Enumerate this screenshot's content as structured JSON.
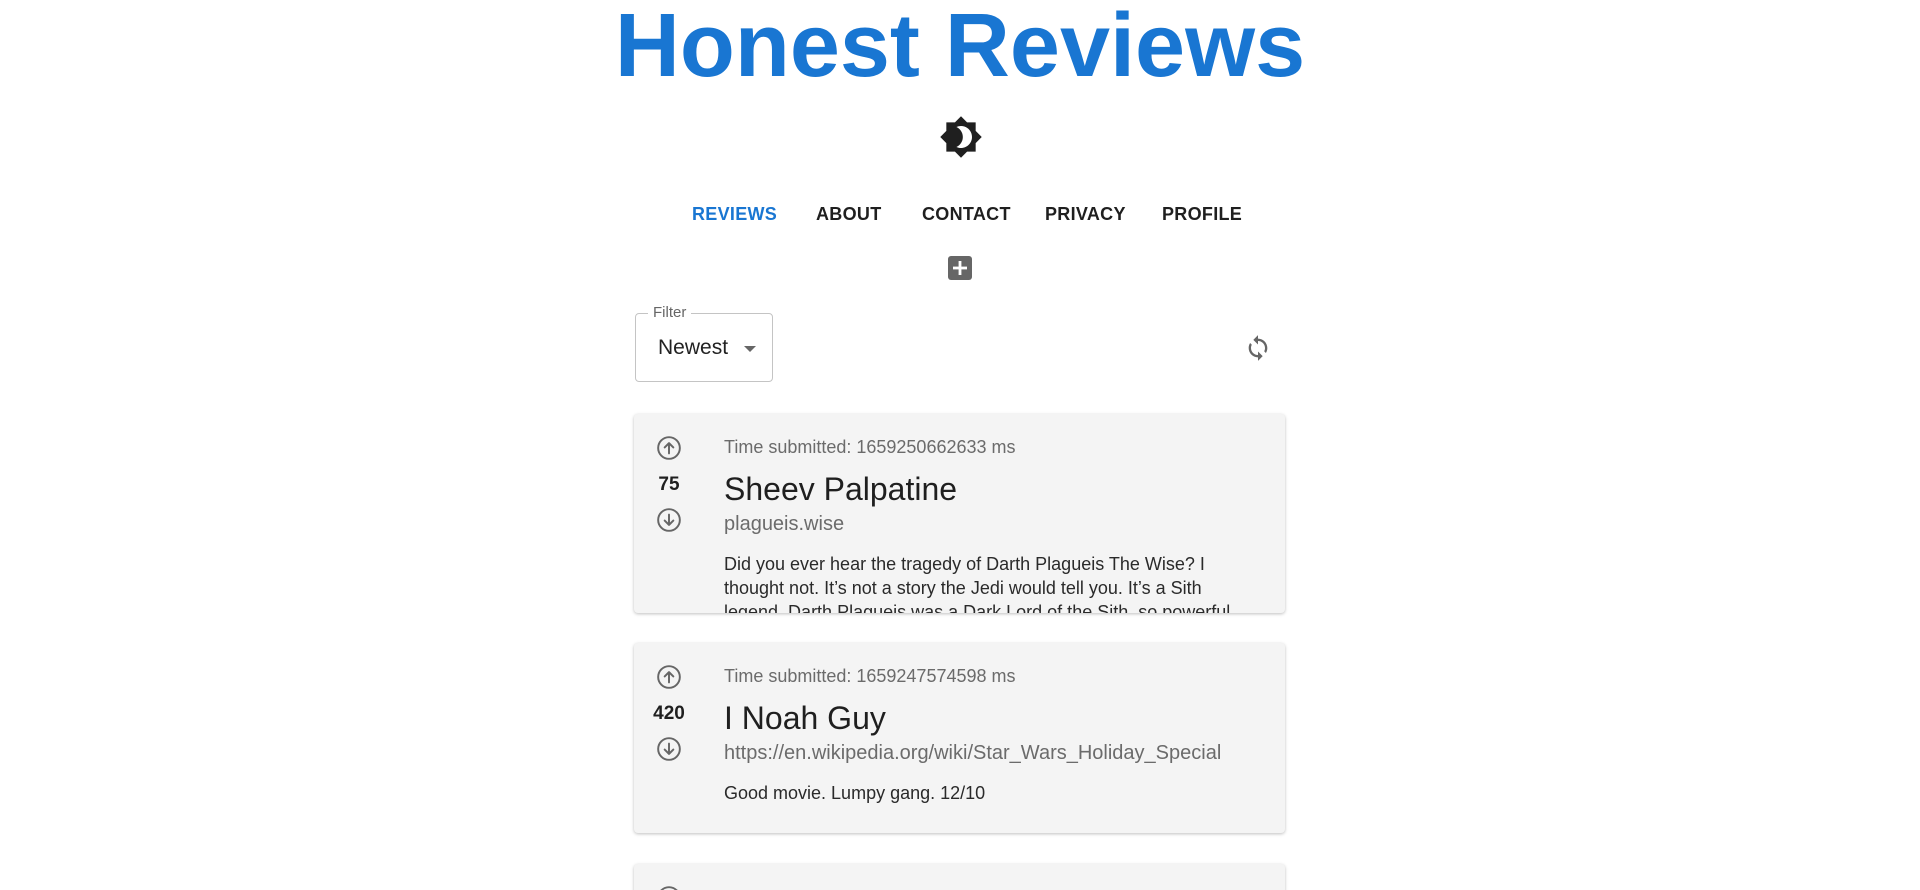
{
  "header": {
    "title": "Honest Reviews",
    "accent_color": "#1976d2"
  },
  "theme_toggle": {
    "icon": "brightness-contrast-icon"
  },
  "nav": {
    "tabs": [
      {
        "label": "REVIEWS",
        "active": true
      },
      {
        "label": "ABOUT",
        "active": false
      },
      {
        "label": "CONTACT",
        "active": false
      },
      {
        "label": "PRIVACY",
        "active": false
      },
      {
        "label": "PROFILE",
        "active": false
      }
    ]
  },
  "toolbar": {
    "add_icon": "add-box-icon",
    "refresh_icon": "refresh-icon"
  },
  "filter": {
    "label": "Filter",
    "value": "Newest"
  },
  "reviews": [
    {
      "votes": "75",
      "time_submitted": "Time submitted: 1659250662633 ms",
      "name": "Sheev Palpatine",
      "link": "plagueis.wise",
      "text": "Did you ever hear the tragedy of Darth Plagueis The Wise? I thought not. It’s not a story the Jedi would tell you. It’s a Sith legend. Darth Plagueis was a Dark Lord of the Sith, so powerful and so wise he"
    },
    {
      "votes": "420",
      "time_submitted": "Time submitted: 1659247574598 ms",
      "name": "I Noah Guy",
      "link": "https://en.wikipedia.org/wiki/Star_Wars_Holiday_Special",
      "text": "Good movie. Lumpy gang. 12/10"
    }
  ]
}
